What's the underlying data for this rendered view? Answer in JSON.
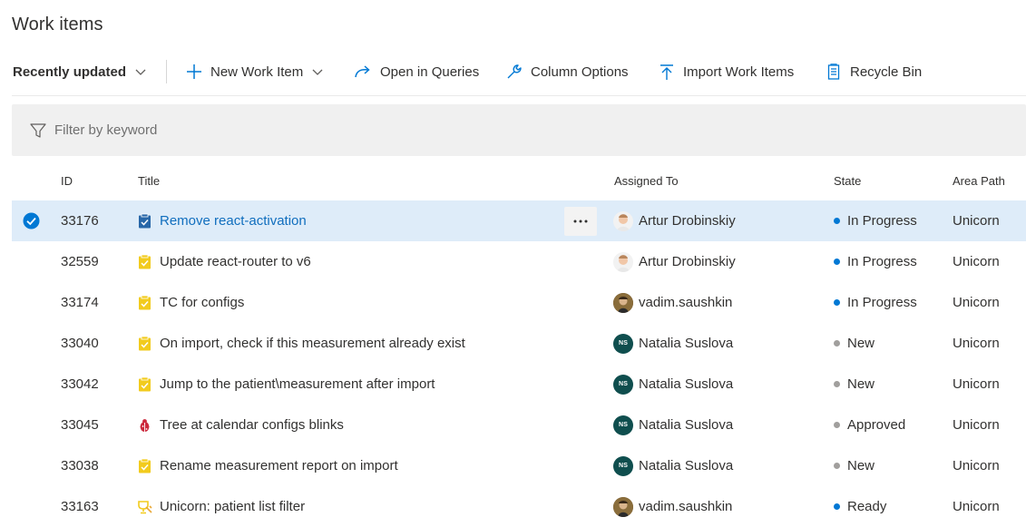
{
  "page": {
    "title": "Work items"
  },
  "toolbar": {
    "view_selector": "Recently updated",
    "new_work_item": "New Work Item",
    "open_in_queries": "Open in Queries",
    "column_options": "Column Options",
    "import_work_items": "Import Work Items",
    "recycle_bin": "Recycle Bin"
  },
  "filter": {
    "placeholder": "Filter by keyword"
  },
  "columns": {
    "id": "ID",
    "title": "Title",
    "assigned_to": "Assigned To",
    "state": "State",
    "area_path": "Area Path"
  },
  "colors": {
    "in_progress": "#0078d4",
    "ready": "#0078d4",
    "new": "#a19f9d",
    "approved": "#a19f9d",
    "selected_row": "#deecf9",
    "link": "#106ebe",
    "task_icon": "#f2cb1d",
    "bug_icon": "#cc293d",
    "feature_icon": "#f2cb1d"
  },
  "rows": [
    {
      "id": "33176",
      "type_icon": "task-icon-selected",
      "title": "Remove react-activation",
      "assigned": "Artur Drobinskiy",
      "avatar": "artur",
      "state": "In Progress",
      "state_color": "#0078d4",
      "area": "Unicorn",
      "selected": true
    },
    {
      "id": "32559",
      "type_icon": "task-icon",
      "title": "Update react-router to v6",
      "assigned": "Artur Drobinskiy",
      "avatar": "artur",
      "state": "In Progress",
      "state_color": "#0078d4",
      "area": "Unicorn"
    },
    {
      "id": "33174",
      "type_icon": "task-icon",
      "title": "TC for configs",
      "assigned": "vadim.saushkin",
      "avatar": "vadim",
      "state": "In Progress",
      "state_color": "#0078d4",
      "area": "Unicorn"
    },
    {
      "id": "33040",
      "type_icon": "task-icon",
      "title": "On import, check if this measurement already exist",
      "assigned": "Natalia Suslova",
      "avatar": "NS",
      "state": "New",
      "state_color": "#a19f9d",
      "area": "Unicorn"
    },
    {
      "id": "33042",
      "type_icon": "task-icon",
      "title": "Jump to the patient\\measurement after import",
      "assigned": "Natalia Suslova",
      "avatar": "NS",
      "state": "New",
      "state_color": "#a19f9d",
      "area": "Unicorn"
    },
    {
      "id": "33045",
      "type_icon": "bug-icon",
      "title": "Tree at calendar configs blinks",
      "assigned": "Natalia Suslova",
      "avatar": "NS",
      "state": "Approved",
      "state_color": "#a19f9d",
      "area": "Unicorn"
    },
    {
      "id": "33038",
      "type_icon": "task-icon",
      "title": "Rename measurement report on import",
      "assigned": "Natalia Suslova",
      "avatar": "NS",
      "state": "New",
      "state_color": "#a19f9d",
      "area": "Unicorn"
    },
    {
      "id": "33163",
      "type_icon": "feature-icon",
      "title": "Unicorn: patient list filter",
      "assigned": "vadim.saushkin",
      "avatar": "vadim",
      "state": "Ready",
      "state_color": "#0078d4",
      "area": "Unicorn"
    }
  ]
}
